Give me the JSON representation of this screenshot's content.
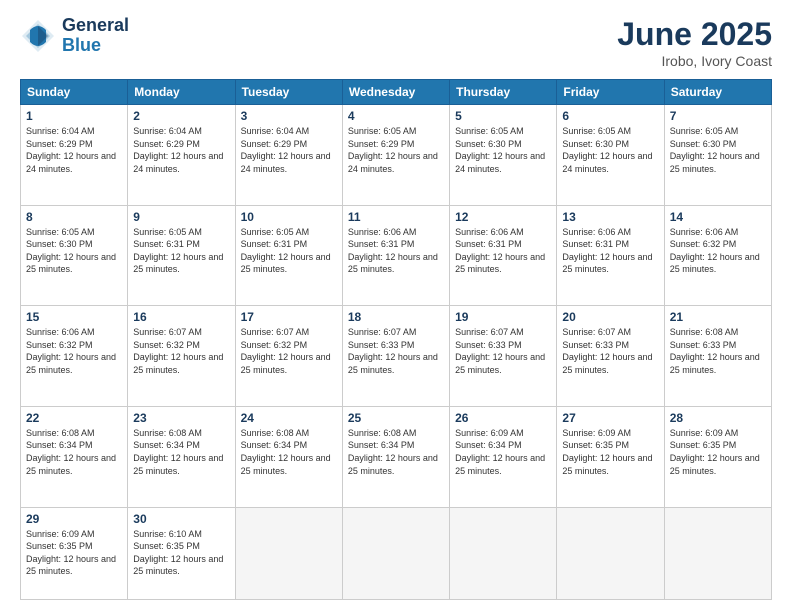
{
  "header": {
    "logo_line1": "General",
    "logo_line2": "Blue",
    "month": "June 2025",
    "location": "Irobo, Ivory Coast"
  },
  "weekdays": [
    "Sunday",
    "Monday",
    "Tuesday",
    "Wednesday",
    "Thursday",
    "Friday",
    "Saturday"
  ],
  "weeks": [
    [
      {
        "day": "1",
        "sunrise": "Sunrise: 6:04 AM",
        "sunset": "Sunset: 6:29 PM",
        "daylight": "Daylight: 12 hours and 24 minutes."
      },
      {
        "day": "2",
        "sunrise": "Sunrise: 6:04 AM",
        "sunset": "Sunset: 6:29 PM",
        "daylight": "Daylight: 12 hours and 24 minutes."
      },
      {
        "day": "3",
        "sunrise": "Sunrise: 6:04 AM",
        "sunset": "Sunset: 6:29 PM",
        "daylight": "Daylight: 12 hours and 24 minutes."
      },
      {
        "day": "4",
        "sunrise": "Sunrise: 6:05 AM",
        "sunset": "Sunset: 6:29 PM",
        "daylight": "Daylight: 12 hours and 24 minutes."
      },
      {
        "day": "5",
        "sunrise": "Sunrise: 6:05 AM",
        "sunset": "Sunset: 6:30 PM",
        "daylight": "Daylight: 12 hours and 24 minutes."
      },
      {
        "day": "6",
        "sunrise": "Sunrise: 6:05 AM",
        "sunset": "Sunset: 6:30 PM",
        "daylight": "Daylight: 12 hours and 24 minutes."
      },
      {
        "day": "7",
        "sunrise": "Sunrise: 6:05 AM",
        "sunset": "Sunset: 6:30 PM",
        "daylight": "Daylight: 12 hours and 25 minutes."
      }
    ],
    [
      {
        "day": "8",
        "sunrise": "Sunrise: 6:05 AM",
        "sunset": "Sunset: 6:30 PM",
        "daylight": "Daylight: 12 hours and 25 minutes."
      },
      {
        "day": "9",
        "sunrise": "Sunrise: 6:05 AM",
        "sunset": "Sunset: 6:31 PM",
        "daylight": "Daylight: 12 hours and 25 minutes."
      },
      {
        "day": "10",
        "sunrise": "Sunrise: 6:05 AM",
        "sunset": "Sunset: 6:31 PM",
        "daylight": "Daylight: 12 hours and 25 minutes."
      },
      {
        "day": "11",
        "sunrise": "Sunrise: 6:06 AM",
        "sunset": "Sunset: 6:31 PM",
        "daylight": "Daylight: 12 hours and 25 minutes."
      },
      {
        "day": "12",
        "sunrise": "Sunrise: 6:06 AM",
        "sunset": "Sunset: 6:31 PM",
        "daylight": "Daylight: 12 hours and 25 minutes."
      },
      {
        "day": "13",
        "sunrise": "Sunrise: 6:06 AM",
        "sunset": "Sunset: 6:31 PM",
        "daylight": "Daylight: 12 hours and 25 minutes."
      },
      {
        "day": "14",
        "sunrise": "Sunrise: 6:06 AM",
        "sunset": "Sunset: 6:32 PM",
        "daylight": "Daylight: 12 hours and 25 minutes."
      }
    ],
    [
      {
        "day": "15",
        "sunrise": "Sunrise: 6:06 AM",
        "sunset": "Sunset: 6:32 PM",
        "daylight": "Daylight: 12 hours and 25 minutes."
      },
      {
        "day": "16",
        "sunrise": "Sunrise: 6:07 AM",
        "sunset": "Sunset: 6:32 PM",
        "daylight": "Daylight: 12 hours and 25 minutes."
      },
      {
        "day": "17",
        "sunrise": "Sunrise: 6:07 AM",
        "sunset": "Sunset: 6:32 PM",
        "daylight": "Daylight: 12 hours and 25 minutes."
      },
      {
        "day": "18",
        "sunrise": "Sunrise: 6:07 AM",
        "sunset": "Sunset: 6:33 PM",
        "daylight": "Daylight: 12 hours and 25 minutes."
      },
      {
        "day": "19",
        "sunrise": "Sunrise: 6:07 AM",
        "sunset": "Sunset: 6:33 PM",
        "daylight": "Daylight: 12 hours and 25 minutes."
      },
      {
        "day": "20",
        "sunrise": "Sunrise: 6:07 AM",
        "sunset": "Sunset: 6:33 PM",
        "daylight": "Daylight: 12 hours and 25 minutes."
      },
      {
        "day": "21",
        "sunrise": "Sunrise: 6:08 AM",
        "sunset": "Sunset: 6:33 PM",
        "daylight": "Daylight: 12 hours and 25 minutes."
      }
    ],
    [
      {
        "day": "22",
        "sunrise": "Sunrise: 6:08 AM",
        "sunset": "Sunset: 6:34 PM",
        "daylight": "Daylight: 12 hours and 25 minutes."
      },
      {
        "day": "23",
        "sunrise": "Sunrise: 6:08 AM",
        "sunset": "Sunset: 6:34 PM",
        "daylight": "Daylight: 12 hours and 25 minutes."
      },
      {
        "day": "24",
        "sunrise": "Sunrise: 6:08 AM",
        "sunset": "Sunset: 6:34 PM",
        "daylight": "Daylight: 12 hours and 25 minutes."
      },
      {
        "day": "25",
        "sunrise": "Sunrise: 6:08 AM",
        "sunset": "Sunset: 6:34 PM",
        "daylight": "Daylight: 12 hours and 25 minutes."
      },
      {
        "day": "26",
        "sunrise": "Sunrise: 6:09 AM",
        "sunset": "Sunset: 6:34 PM",
        "daylight": "Daylight: 12 hours and 25 minutes."
      },
      {
        "day": "27",
        "sunrise": "Sunrise: 6:09 AM",
        "sunset": "Sunset: 6:35 PM",
        "daylight": "Daylight: 12 hours and 25 minutes."
      },
      {
        "day": "28",
        "sunrise": "Sunrise: 6:09 AM",
        "sunset": "Sunset: 6:35 PM",
        "daylight": "Daylight: 12 hours and 25 minutes."
      }
    ],
    [
      {
        "day": "29",
        "sunrise": "Sunrise: 6:09 AM",
        "sunset": "Sunset: 6:35 PM",
        "daylight": "Daylight: 12 hours and 25 minutes."
      },
      {
        "day": "30",
        "sunrise": "Sunrise: 6:10 AM",
        "sunset": "Sunset: 6:35 PM",
        "daylight": "Daylight: 12 hours and 25 minutes."
      },
      null,
      null,
      null,
      null,
      null
    ]
  ]
}
